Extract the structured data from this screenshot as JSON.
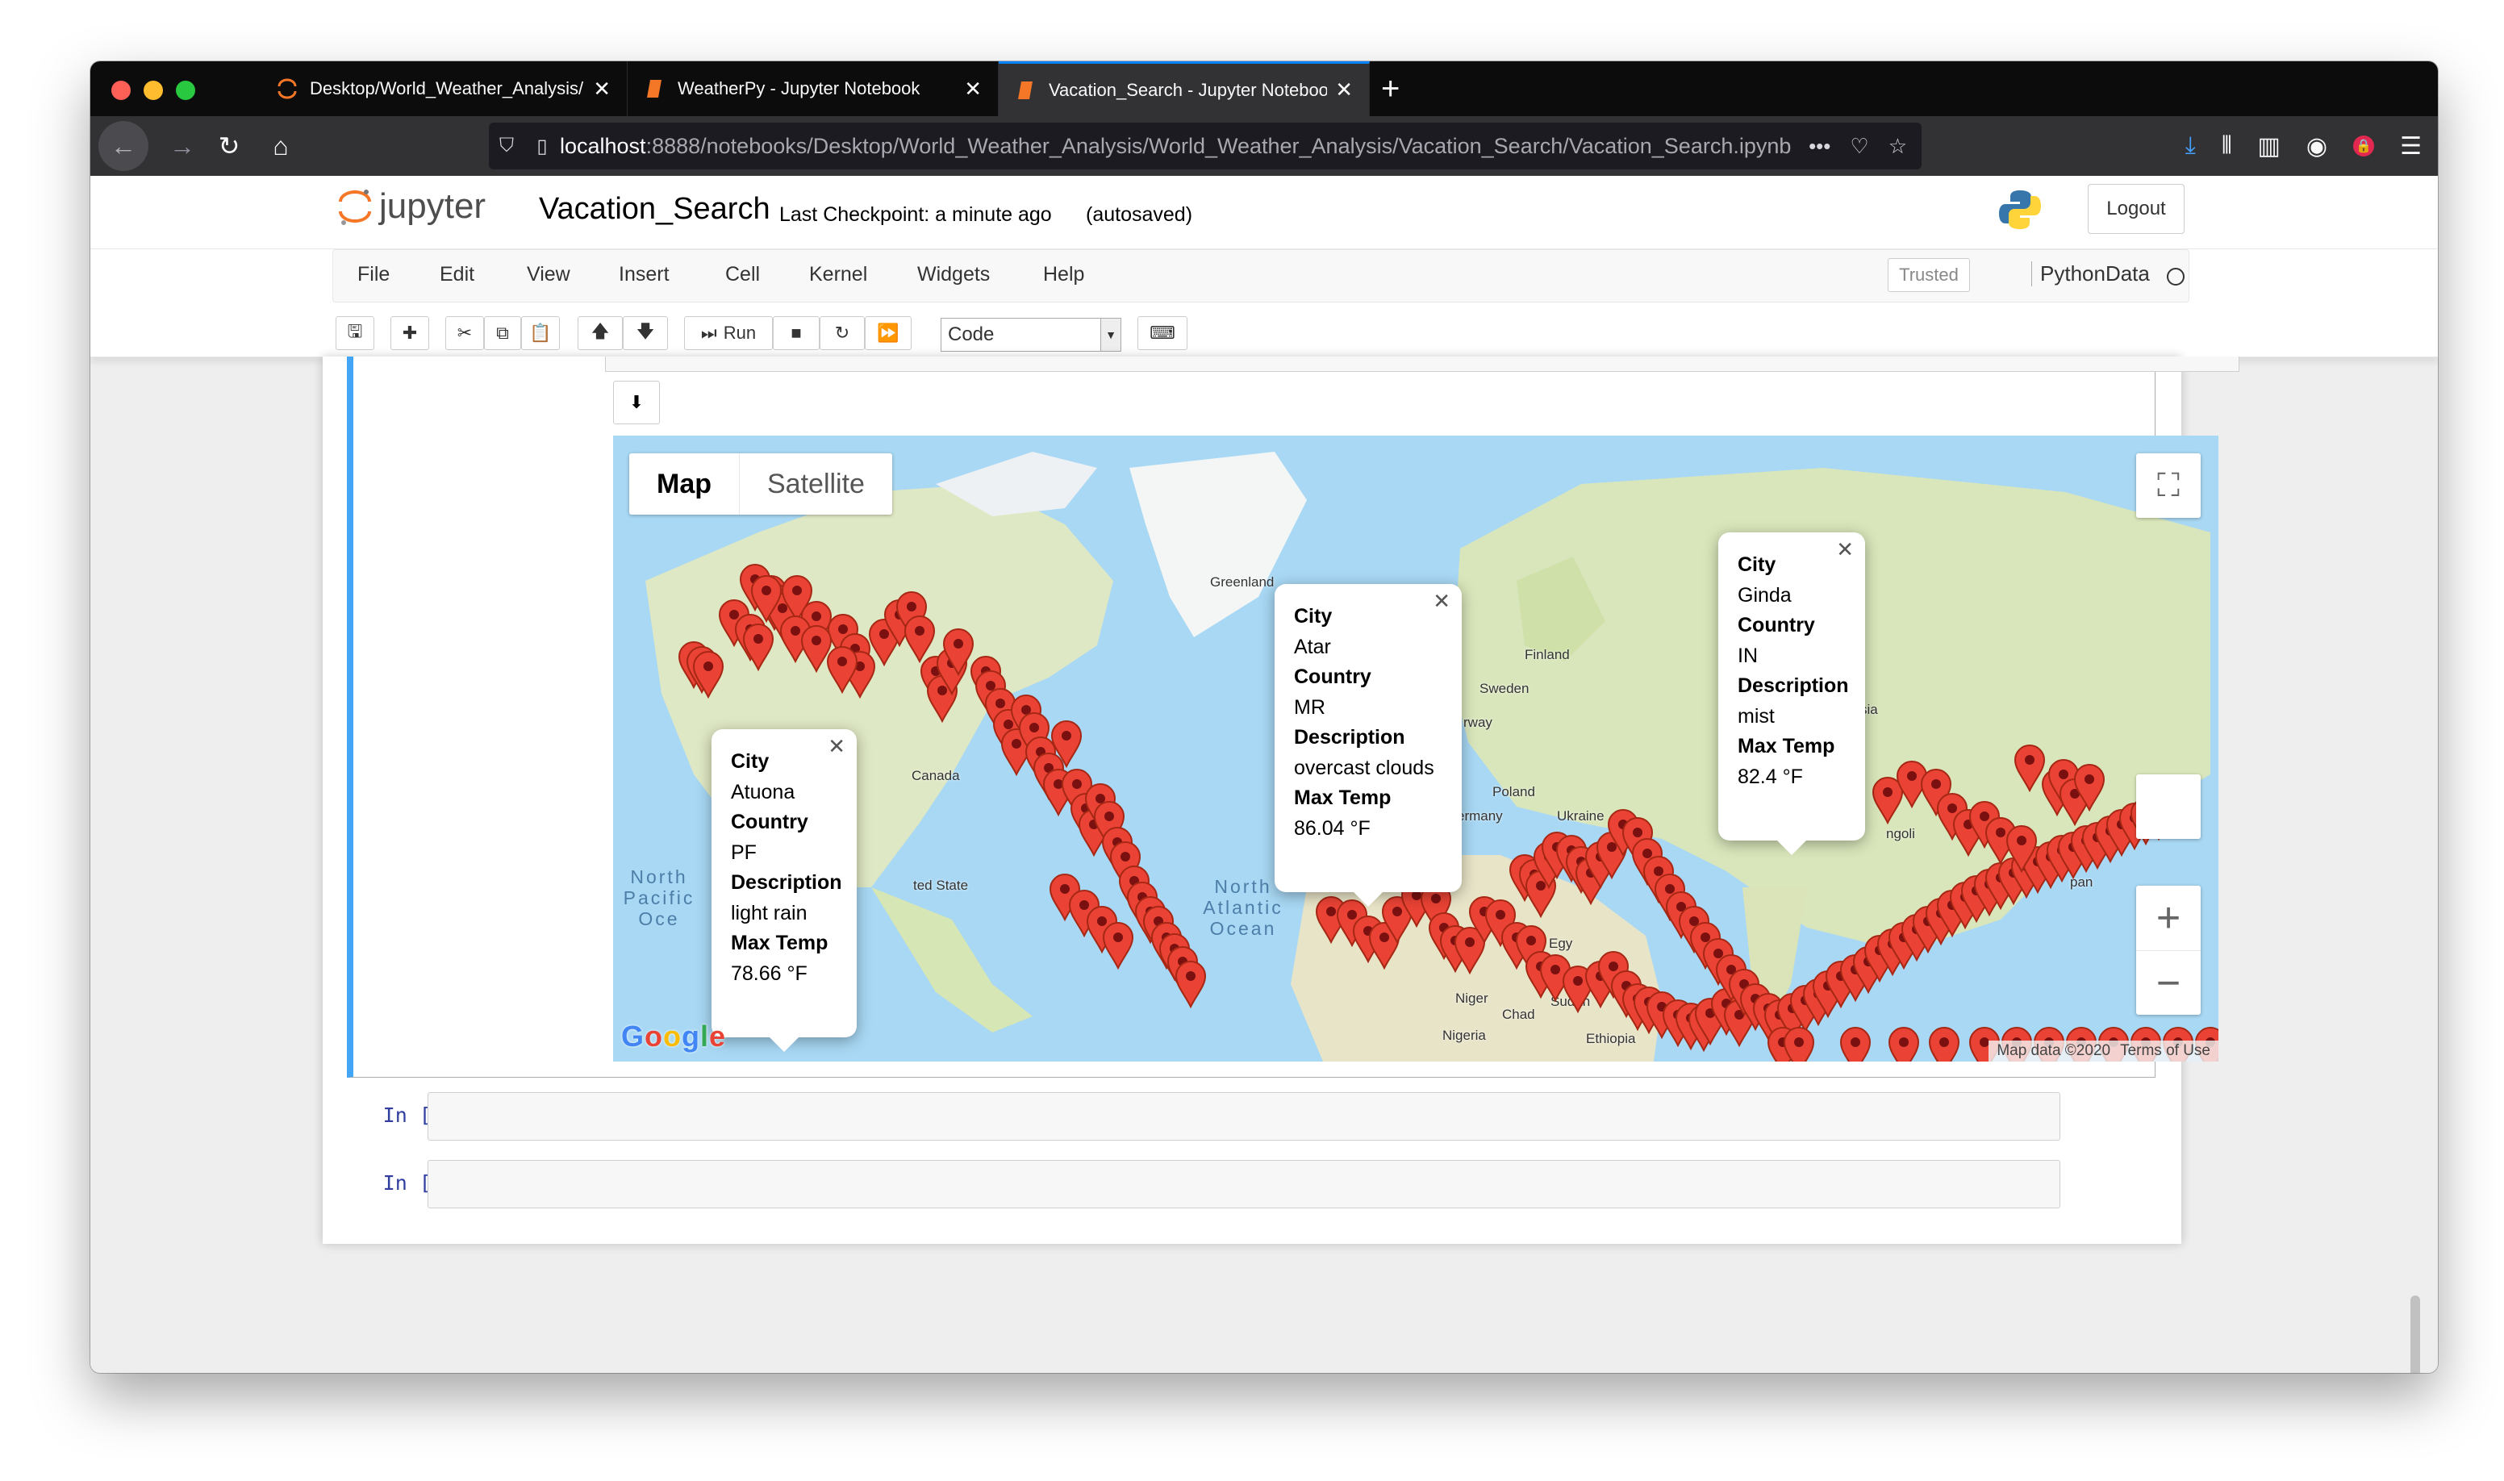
{
  "browser": {
    "tabs": [
      {
        "title": "Desktop/World_Weather_Analysis/",
        "active": false
      },
      {
        "title": "WeatherPy - Jupyter Notebook",
        "active": false
      },
      {
        "title": "Vacation_Search - Jupyter Notebook",
        "active": true
      }
    ],
    "url_host": "localhost",
    "url_path": ":8888/notebooks/Desktop/World_Weather_Analysis/World_Weather_Analysis/Vacation_Search/Vacation_Search.ipynb",
    "url_more": "•••"
  },
  "jupyter": {
    "logo_text": "jupyter",
    "notebook_title": "Vacation_Search",
    "checkpoint": "Last Checkpoint: a minute ago",
    "autosave": "(autosaved)",
    "logout_label": "Logout",
    "menu": [
      "File",
      "Edit",
      "View",
      "Insert",
      "Cell",
      "Kernel",
      "Widgets",
      "Help"
    ],
    "trusted_label": "Trusted",
    "kernel_name": "PythonData",
    "toolbar": {
      "run_label": "Run",
      "cell_type": "Code"
    }
  },
  "map": {
    "type_map": "Map",
    "type_satellite": "Satellite",
    "google": "Google",
    "credits": "Map data ©2020",
    "terms": "Terms of Use",
    "labels": [
      "Greenland",
      "Finland",
      "Sweden",
      "rway",
      "Poland",
      "Ukraine",
      "ermany",
      "Canada",
      "ted State",
      "Egy",
      "Sudan",
      "Niger",
      "Chad",
      "Nigeria",
      "Ethiopia",
      "ngoli",
      "pan",
      "sia"
    ],
    "oceans": {
      "north_pacific": "North Pacific Oce",
      "north_atlantic": "North Atlantic Ocean"
    },
    "popups": [
      {
        "city": "Atuona",
        "country": "PF",
        "description": "light rain",
        "max_temp": "78.66 °F"
      },
      {
        "city": "Atar",
        "country": "MR",
        "description": "overcast clouds",
        "max_temp": "86.04 °F"
      },
      {
        "city": "Ginda",
        "country": "IN",
        "description": "mist",
        "max_temp": "82.4 °F"
      }
    ],
    "field_labels": {
      "city": "City",
      "country": "Country",
      "description": "Description",
      "max_temp": "Max Temp"
    }
  },
  "cells": [
    {
      "prompt": "In [ ]:"
    },
    {
      "prompt": "In [ ]:"
    }
  ]
}
